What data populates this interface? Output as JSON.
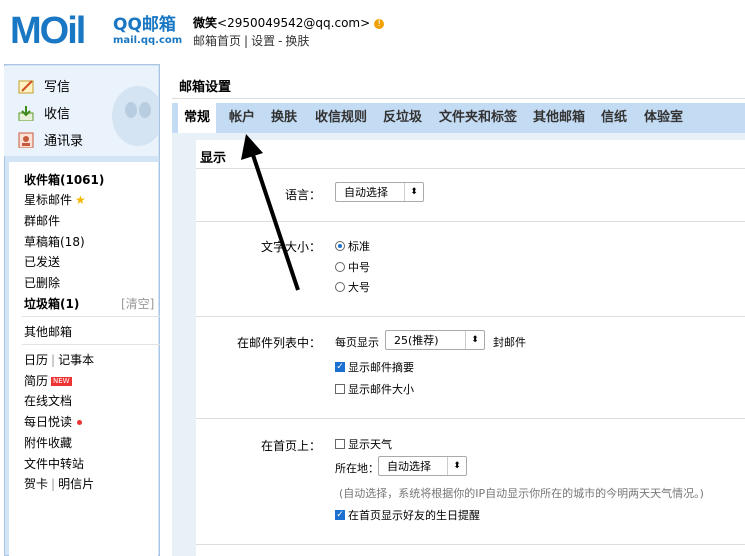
{
  "header": {
    "logo_mark": "MOil",
    "logo_title": "QQ邮箱",
    "logo_sub": "mail.qq.com",
    "user_name": "微笑",
    "user_email": "<2950049542@qq.com>",
    "alert_glyph": "!",
    "link_home": "邮箱首页",
    "link_settings": "设置",
    "link_skin": "换肤",
    "sep1": "|",
    "sep2": "-"
  },
  "compose": {
    "write": "写信",
    "receive": "收信",
    "contacts": "通讯录"
  },
  "folders": {
    "inbox": "收件箱(1061)",
    "starred": "星标邮件",
    "group": "群邮件",
    "drafts": "草稿箱(18)",
    "sent": "已发送",
    "deleted": "已删除",
    "spam": "垃圾箱(1)",
    "clear": "[清空]",
    "other": "其他邮箱",
    "calendar": "日历",
    "notes": "记事本",
    "resume": "简历",
    "new_badge": "NEW",
    "docs": "在线文档",
    "daily": "每日悦读",
    "attach": "附件收藏",
    "transfer": "文件中转站",
    "card": "贺卡",
    "postcard": "明信片",
    "sep": "|",
    "star_glyph": "★"
  },
  "main": {
    "title": "邮箱设置",
    "tabs": [
      "常规",
      "帐户",
      "换肤",
      "收信规则",
      "反垃圾",
      "文件夹和标签",
      "其他邮箱",
      "信纸",
      "体验室"
    ],
    "section": "显示",
    "lang_label": "语言：",
    "lang_value": "自动选择",
    "font_label": "文字大小：",
    "font_options": [
      "标准",
      "中号",
      "大号"
    ],
    "list_label": "在邮件列表中：",
    "per_page": "每页显示",
    "per_page_value": "25(推荐)",
    "per_page_unit": "封邮件",
    "show_summary": "显示邮件摘要",
    "show_size": "显示邮件大小",
    "home_label": "在首页上：",
    "show_weather": "显示天气",
    "location_label": "所在地：",
    "location_value": "自动选择",
    "note": "(自动选择，系统将根据你的IP自动显示你所在的城市的今明两天天气情况。)",
    "birthday": "在首页显示好友的生日提醒",
    "select_arrow": "⬍",
    "check_glyph": "✓"
  }
}
